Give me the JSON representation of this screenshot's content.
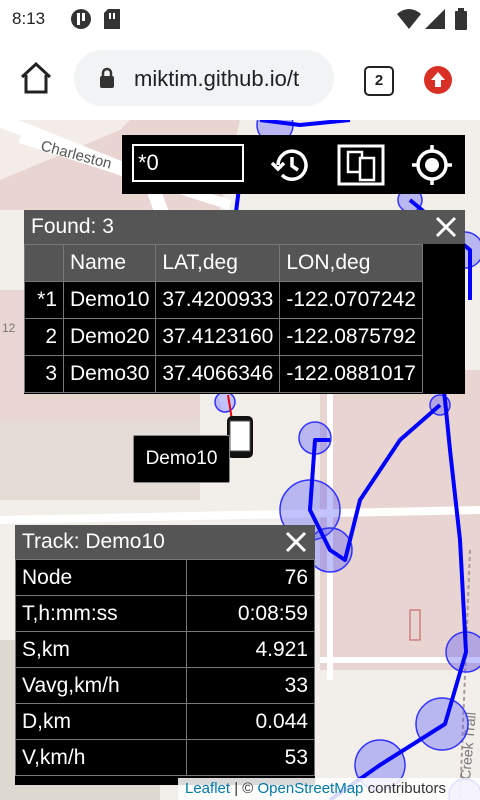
{
  "status_bar": {
    "time": "8:13"
  },
  "browser": {
    "url": "miktim.github.io/t",
    "tab_count": "2"
  },
  "toolbar": {
    "search_value": "*0"
  },
  "found": {
    "title": "Found: 3",
    "columns": [
      "",
      "Name",
      "LAT,deg",
      "LON,deg"
    ],
    "rows": [
      {
        "idx": "*1",
        "name": "Demo10",
        "lat": "37.4200933",
        "lon": "-122.0707242"
      },
      {
        "idx": "2",
        "name": "Demo20",
        "lat": "37.4123160",
        "lon": "-122.0875792"
      },
      {
        "idx": "3",
        "name": "Demo30",
        "lat": "37.4066346",
        "lon": "-122.0881017"
      }
    ]
  },
  "marker": {
    "label": "Demo10"
  },
  "track": {
    "title": "Track: Demo10",
    "rows": [
      {
        "label": "Node",
        "value": "76"
      },
      {
        "label": "T,h:mm:ss",
        "value": "0:08:59"
      },
      {
        "label": "S,km",
        "value": "4.921"
      },
      {
        "label": "Vavg,km/h",
        "value": "33"
      },
      {
        "label": "D,km",
        "value": "0.044"
      },
      {
        "label": "V,km/h",
        "value": "53"
      }
    ]
  },
  "map_labels": {
    "street1": "Charleston",
    "street2": "Creek Trail",
    "num": "12"
  },
  "attribution": {
    "leaflet": "Leaflet",
    "sep": " | © ",
    "osm": "OpenStreetMap",
    "tail": " contributors"
  },
  "colors": {
    "track": "#0000ff",
    "accent": "#d93025"
  }
}
